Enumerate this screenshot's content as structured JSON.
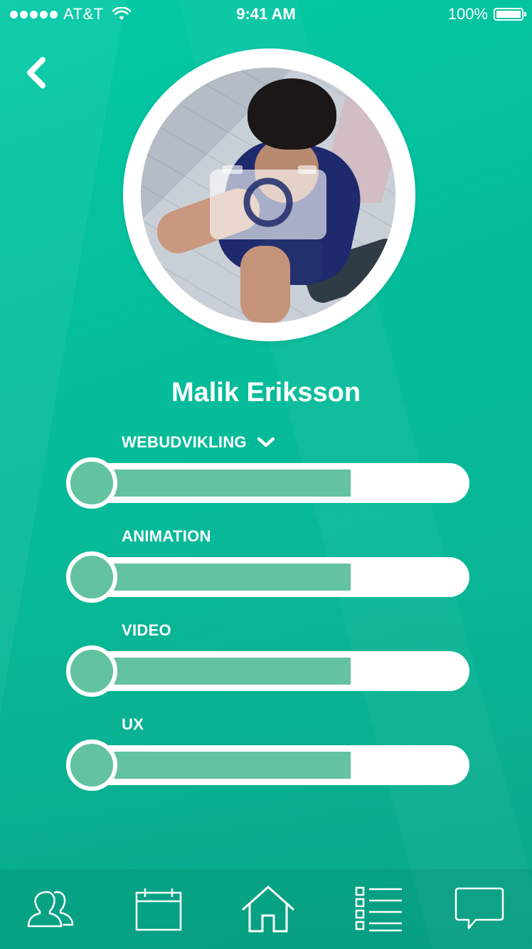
{
  "status_bar": {
    "carrier": "AT&T",
    "time": "9:41 AM",
    "battery": "100%"
  },
  "profile": {
    "name": "Malik Eriksson"
  },
  "skills": [
    {
      "label": "WEBUDVIKLING",
      "level": 0.67,
      "has_dropdown": true
    },
    {
      "label": "ANIMATION",
      "level": 0.67,
      "has_dropdown": false
    },
    {
      "label": "VIDEO",
      "level": 0.67,
      "has_dropdown": false
    },
    {
      "label": "UX",
      "level": 0.67,
      "has_dropdown": false
    }
  ],
  "colors": {
    "background": "#06bc9a",
    "skill_fill": "#63c29f",
    "white": "#ffffff"
  },
  "nav": {
    "items": [
      {
        "icon": "people-icon"
      },
      {
        "icon": "calendar-icon"
      },
      {
        "icon": "home-icon"
      },
      {
        "icon": "checklist-icon"
      },
      {
        "icon": "chat-icon"
      }
    ]
  }
}
